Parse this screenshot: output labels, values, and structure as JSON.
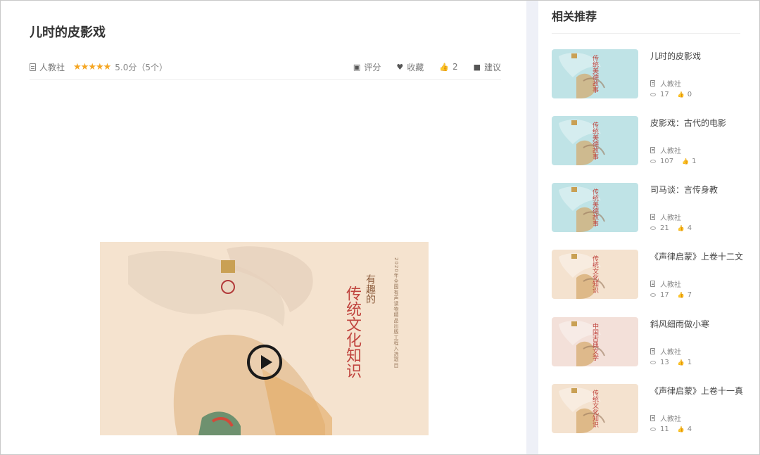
{
  "page": {
    "title": "儿时的皮影戏",
    "publisher": "人教社",
    "stars": "★★★★★",
    "score": "5.0分（5个）",
    "actions": {
      "rate_label": "评分",
      "favorite_label": "收藏",
      "like_count": "2",
      "suggest_label": "建议"
    }
  },
  "video": {
    "cover_title": "传统文化知识",
    "cover_subtitle": "有趣的",
    "cover_side_text": "2020年全国有声读物精品出版工程入选项目"
  },
  "sidebar": {
    "title": "相关推荐",
    "items": [
      {
        "name": "儿时的皮影戏",
        "publisher": "人教社",
        "views": "17",
        "likes": "0",
        "thumb": "blue",
        "thumb_text": "传统美德故事"
      },
      {
        "name": "皮影戏：古代的电影",
        "publisher": "人教社",
        "views": "107",
        "likes": "1",
        "thumb": "blue",
        "thumb_text": "传统美德故事"
      },
      {
        "name": "司马谈：言传身教",
        "publisher": "人教社",
        "views": "21",
        "likes": "4",
        "thumb": "blue",
        "thumb_text": "传统美德故事"
      },
      {
        "name": "《声律启蒙》上卷十二文",
        "publisher": "人教社",
        "views": "17",
        "likes": "7",
        "thumb": "peach",
        "thumb_text": "传统文化知识"
      },
      {
        "name": "斜风细雨做小寒",
        "publisher": "人教社",
        "views": "13",
        "likes": "1",
        "thumb": "pink",
        "thumb_text": "中国古典文学"
      },
      {
        "name": "《声律启蒙》上卷十一真",
        "publisher": "人教社",
        "views": "11",
        "likes": "4",
        "thumb": "peach",
        "thumb_text": "传统文化知识"
      }
    ]
  },
  "colors": {
    "star": "#f5a623",
    "accent_red": "#c0443e",
    "gap": "#eef0f7"
  }
}
